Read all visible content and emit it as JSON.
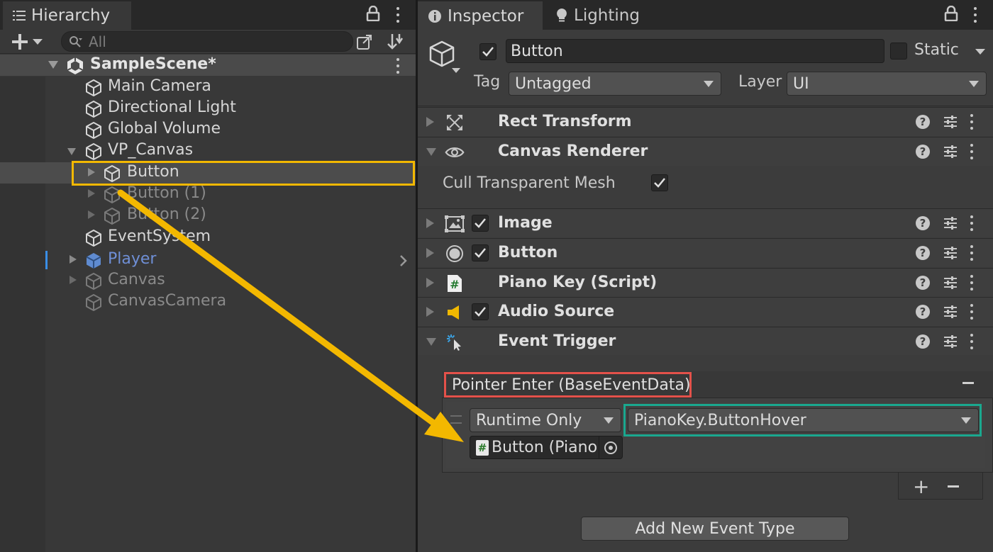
{
  "hierarchy": {
    "tab_label": "Hierarchy",
    "search_placeholder": "All",
    "scene": "SampleScene*",
    "items": [
      {
        "label": "Main Camera"
      },
      {
        "label": "Directional Light"
      },
      {
        "label": "Global Volume"
      },
      {
        "label": "VP_Canvas"
      },
      {
        "label": "Button"
      },
      {
        "label": "Button (1)"
      },
      {
        "label": "Button (2)"
      },
      {
        "label": "EventSystem"
      },
      {
        "label": "Player"
      },
      {
        "label": "Canvas"
      },
      {
        "label": "CanvasCamera"
      }
    ]
  },
  "inspector": {
    "tabs": [
      {
        "label": "Inspector"
      },
      {
        "label": "Lighting"
      }
    ],
    "object_name": "Button",
    "static_label": "Static",
    "tag_label": "Tag",
    "tag_value": "Untagged",
    "layer_label": "Layer",
    "layer_value": "UI",
    "components": [
      {
        "name": "Rect Transform"
      },
      {
        "name": "Canvas Renderer"
      },
      {
        "name": "Image"
      },
      {
        "name": "Button"
      },
      {
        "name": "Piano Key (Script)"
      },
      {
        "name": "Audio Source"
      },
      {
        "name": "Event Trigger"
      }
    ],
    "cull_label": "Cull Transparent Mesh",
    "event": {
      "title": "Pointer Enter (BaseEventData)",
      "runtime": "Runtime Only",
      "function": "PianoKey.ButtonHover",
      "target": "Button (Piano",
      "add_button": "Add New Event Type"
    }
  },
  "colors": {
    "highlight_yellow": "#f3b800",
    "highlight_red": "#e4514a",
    "highlight_teal": "#1aa88f",
    "player_blue": "#6f8fd6"
  }
}
